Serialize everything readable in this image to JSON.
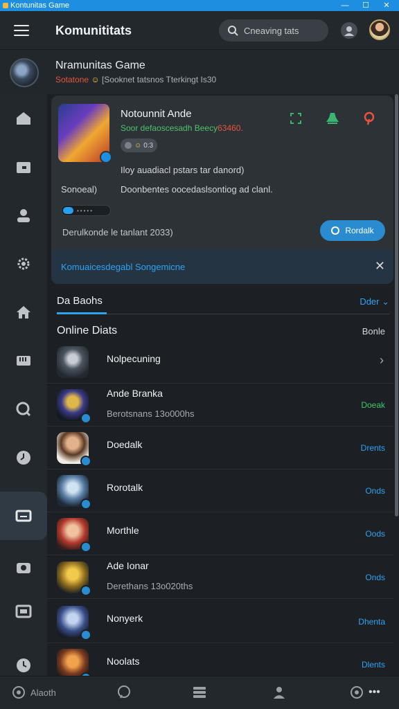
{
  "window": {
    "title": "Kontunitas Game",
    "controls": [
      "—",
      "☐",
      "✕"
    ]
  },
  "header": {
    "app_title": "Komunititats",
    "search_placeholder": "Cneaving tats"
  },
  "group": {
    "name": "Nramunitas Game",
    "status_hot": "Sotatone",
    "status_emoji": "☺",
    "status_text": "[Sooknet tatsnos Tterkingt Is30"
  },
  "sidebar": {
    "items": [
      {
        "icon": "home-icon"
      },
      {
        "icon": "folder-icon"
      },
      {
        "icon": "person-icon"
      },
      {
        "icon": "gear-icon"
      },
      {
        "icon": "house-icon"
      },
      {
        "icon": "grid-icon"
      },
      {
        "icon": "search-icon"
      },
      {
        "icon": "clock-icon"
      },
      {
        "icon": "chat-icon",
        "active": true
      },
      {
        "icon": "camera-icon"
      },
      {
        "icon": "gallery-icon"
      },
      {
        "icon": "history-icon"
      }
    ]
  },
  "featured": {
    "title": "Notounnit Ande",
    "subtitle": "Soor defaoscesadh Beecy",
    "subtitle_hot": "63460.",
    "pill_text": "0:3",
    "description": "Iloy auadiacl pstars tar danord)",
    "label": "Sonoeal)",
    "detail": "Doonbentes oocedaslsontiog ad clanl.",
    "progress": 0.22,
    "footer": "Derulkonde le tanlant 2033)",
    "button_label": "Rordalk",
    "notice": "Komuaicesdegabl Songemicne",
    "close_symbol": "✕",
    "accent_colors": [
      "#4cc36e",
      "#3cb371",
      "#e8533f"
    ]
  },
  "tabs": {
    "active": "Da Baohs",
    "filter": "Dder ⌄"
  },
  "section": {
    "title": "Online Diats",
    "action": "Bonle"
  },
  "members": [
    {
      "name": "Nolpecuning",
      "sub": "",
      "status": "›",
      "type": "chevron"
    },
    {
      "name": "Ande Branka",
      "sub": "Berotsnans 13o000hs",
      "status": "Doeak",
      "type": "green"
    },
    {
      "name": "Doedalk",
      "sub": "",
      "status": "Drents",
      "type": "blue"
    },
    {
      "name": "Rorotalk",
      "sub": "",
      "status": "Onds",
      "type": "blue"
    },
    {
      "name": "Morthle",
      "sub": "",
      "status": "Oods",
      "type": "blue"
    },
    {
      "name": "Ade Ionar",
      "sub": "Derethans 13o020ths",
      "status": "Onds",
      "type": "blue"
    },
    {
      "name": "Nonyerk",
      "sub": "",
      "status": "Dhenta",
      "type": "blue"
    },
    {
      "name": "Noolats",
      "sub": "",
      "status": "Dlents",
      "type": "blue"
    }
  ],
  "bottom_bar": {
    "first_label": "Alaoth",
    "items": [
      "chat-bubble-icon",
      "apps-grid-icon",
      "user-group-icon",
      "settings-icon",
      "more-icon"
    ],
    "more_label": "•••"
  }
}
